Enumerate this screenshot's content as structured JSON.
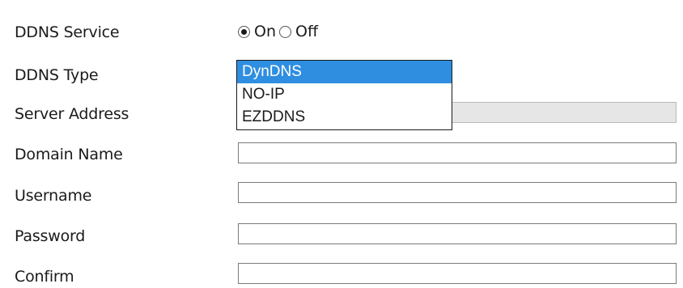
{
  "labels": {
    "ddns_service": "DDNS Service",
    "ddns_type": "DDNS Type",
    "server_address": "Server Address",
    "domain_name": "Domain Name",
    "username": "Username",
    "password": "Password",
    "confirm": "Confirm"
  },
  "ddns_service": {
    "options": [
      {
        "label": "On",
        "checked": true
      },
      {
        "label": "Off",
        "checked": false
      }
    ]
  },
  "ddns_type": {
    "options": [
      "DynDNS",
      "NO-IP",
      "EZDDNS"
    ],
    "selected": "DynDNS"
  },
  "fields": {
    "server_address": {
      "value": "",
      "disabled": true
    },
    "domain_name": {
      "value": ""
    },
    "username": {
      "value": ""
    },
    "password": {
      "value": ""
    },
    "confirm": {
      "value": ""
    }
  },
  "colors": {
    "selection": "#2f8ee0",
    "disabled_field": "#e6e6e6",
    "border": "#7a7a7a"
  }
}
